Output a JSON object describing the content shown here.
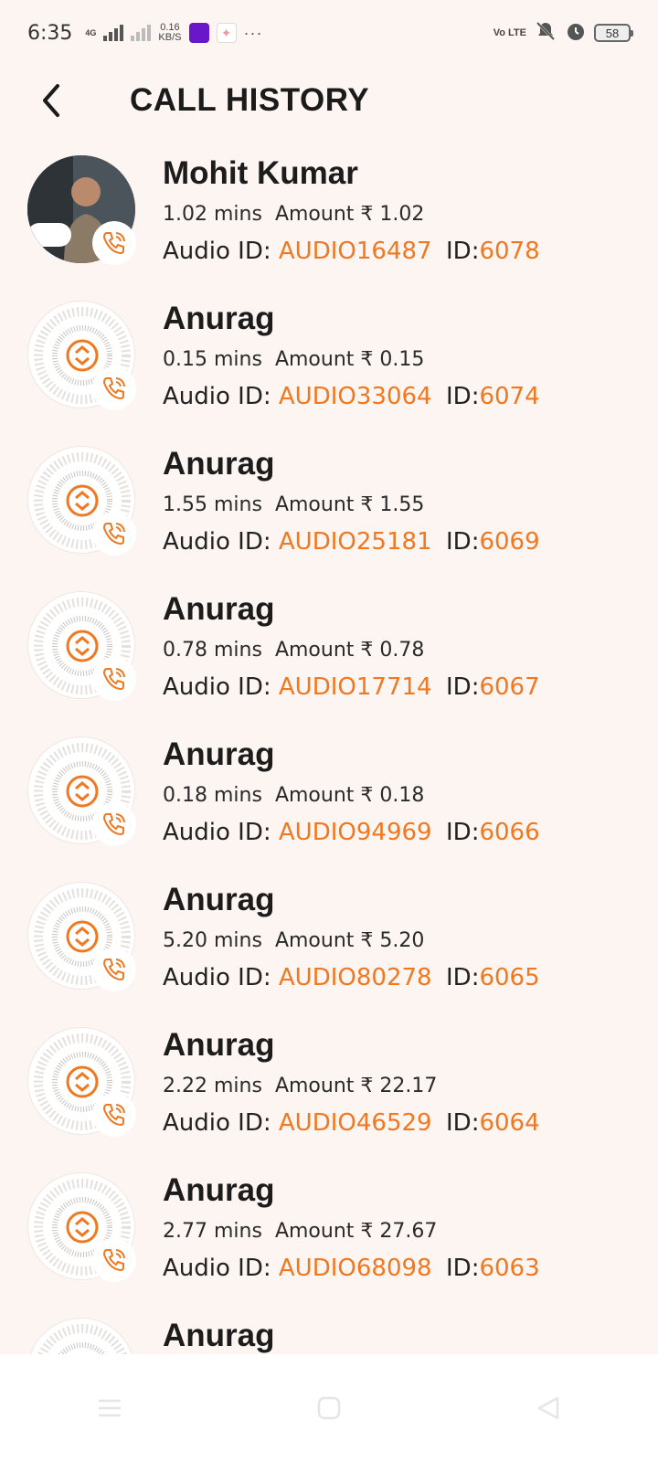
{
  "status_bar": {
    "time": "6:35",
    "network_type": "4G",
    "speed_value": "0.16",
    "speed_unit": "KB/S",
    "volte": "Vo LTE",
    "battery": "58"
  },
  "header": {
    "title": "CALL HISTORY"
  },
  "labels": {
    "mins_suffix": "mins",
    "amount_label": "Amount ₹",
    "audio_label": "Audio ID:",
    "id_label": "ID:"
  },
  "calls": [
    {
      "name": "Mohit Kumar",
      "duration": "1.02",
      "amount": "1.02",
      "audio_id": "AUDIO16487",
      "id": "6078"
    },
    {
      "name": "Anurag",
      "duration": "0.15",
      "amount": "0.15",
      "audio_id": "AUDIO33064",
      "id": "6074"
    },
    {
      "name": "Anurag",
      "duration": "1.55",
      "amount": "1.55",
      "audio_id": "AUDIO25181",
      "id": "6069"
    },
    {
      "name": "Anurag",
      "duration": "0.78",
      "amount": "0.78",
      "audio_id": "AUDIO17714",
      "id": "6067"
    },
    {
      "name": "Anurag",
      "duration": "0.18",
      "amount": "0.18",
      "audio_id": "AUDIO94969",
      "id": "6066"
    },
    {
      "name": "Anurag",
      "duration": "5.20",
      "amount": "5.20",
      "audio_id": "AUDIO80278",
      "id": "6065"
    },
    {
      "name": "Anurag",
      "duration": "2.22",
      "amount": "22.17",
      "audio_id": "AUDIO46529",
      "id": "6064"
    },
    {
      "name": "Anurag",
      "duration": "2.77",
      "amount": "27.67",
      "audio_id": "AUDIO68098",
      "id": "6063"
    },
    {
      "name": "Anurag"
    }
  ],
  "colors": {
    "accent": "#f07820",
    "background": "#fdf5f1"
  },
  "icons": {
    "back": "chevron-left-icon",
    "call": "phone-call-icon",
    "nav_menu": "menu-icon",
    "nav_home": "home-icon",
    "nav_back": "triangle-back-icon"
  }
}
